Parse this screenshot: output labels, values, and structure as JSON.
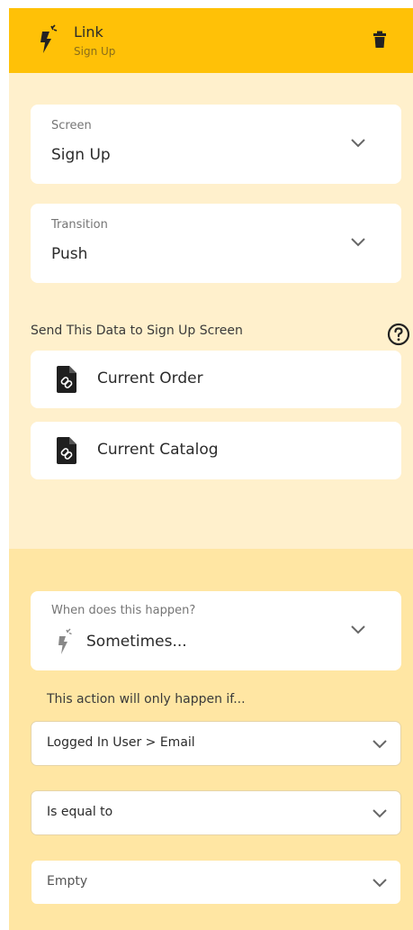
{
  "header": {
    "title": "Link",
    "subtitle": "Sign Up",
    "icon": "lightning-sparkle-icon",
    "delete_icon": "trash-icon",
    "bg_color": "#ffc107"
  },
  "screen": {
    "label": "Screen",
    "value": "Sign Up"
  },
  "transition": {
    "label": "Transition",
    "value": "Push"
  },
  "send_data": {
    "label": "Send This Data to Sign Up Screen",
    "help_icon": "help-circle-icon",
    "items": [
      {
        "label": "Current Order",
        "icon": "linked-document-icon"
      },
      {
        "label": "Current Catalog",
        "icon": "linked-document-icon"
      }
    ]
  },
  "condition": {
    "when_label": "When does this happen?",
    "when_value": "Sometimes...",
    "only_if_label": "This action will only happen if...",
    "field": "Logged In User > Email",
    "operator": "Is equal to",
    "value": "Empty"
  },
  "colors": {
    "panel_bg": "#fff0cc",
    "condition_bg": "#ffe6a3",
    "accent": "#ffc107"
  }
}
